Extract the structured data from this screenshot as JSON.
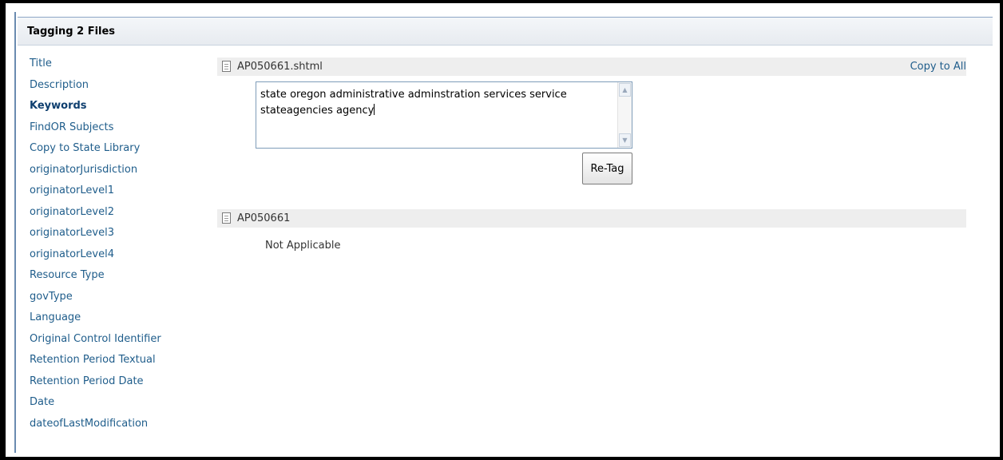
{
  "header": {
    "title": "Tagging 2 Files"
  },
  "sidebar": {
    "items": [
      {
        "label": "Title"
      },
      {
        "label": "Description"
      },
      {
        "label": "Keywords",
        "active": true
      },
      {
        "label": "FindOR Subjects"
      },
      {
        "label": "Copy to State Library"
      },
      {
        "label": "originatorJurisdiction"
      },
      {
        "label": "originatorLevel1"
      },
      {
        "label": "originatorLevel2"
      },
      {
        "label": "originatorLevel3"
      },
      {
        "label": "originatorLevel4"
      },
      {
        "label": "Resource Type"
      },
      {
        "label": "govType"
      },
      {
        "label": "Language"
      },
      {
        "label": "Original Control Identifier"
      },
      {
        "label": "Retention Period Textual"
      },
      {
        "label": "Retention Period Date"
      },
      {
        "label": "Date"
      },
      {
        "label": "dateofLastModification"
      }
    ]
  },
  "files": [
    {
      "name": "AP050661.shtml",
      "copy_label": "Copy to All",
      "keywords_value": "state oregon administrative adminstration services service stateagencies agency",
      "retag_label": "Re-Tag",
      "icon": "document-icon"
    },
    {
      "name": "AP050661",
      "status_text": "Not Applicable",
      "icon": "document-icon"
    }
  ],
  "colors": {
    "link": "#1f5d8b",
    "frame": "#000000",
    "accent_line": "#6a8bb0",
    "file_bar": "#eeeeee"
  }
}
